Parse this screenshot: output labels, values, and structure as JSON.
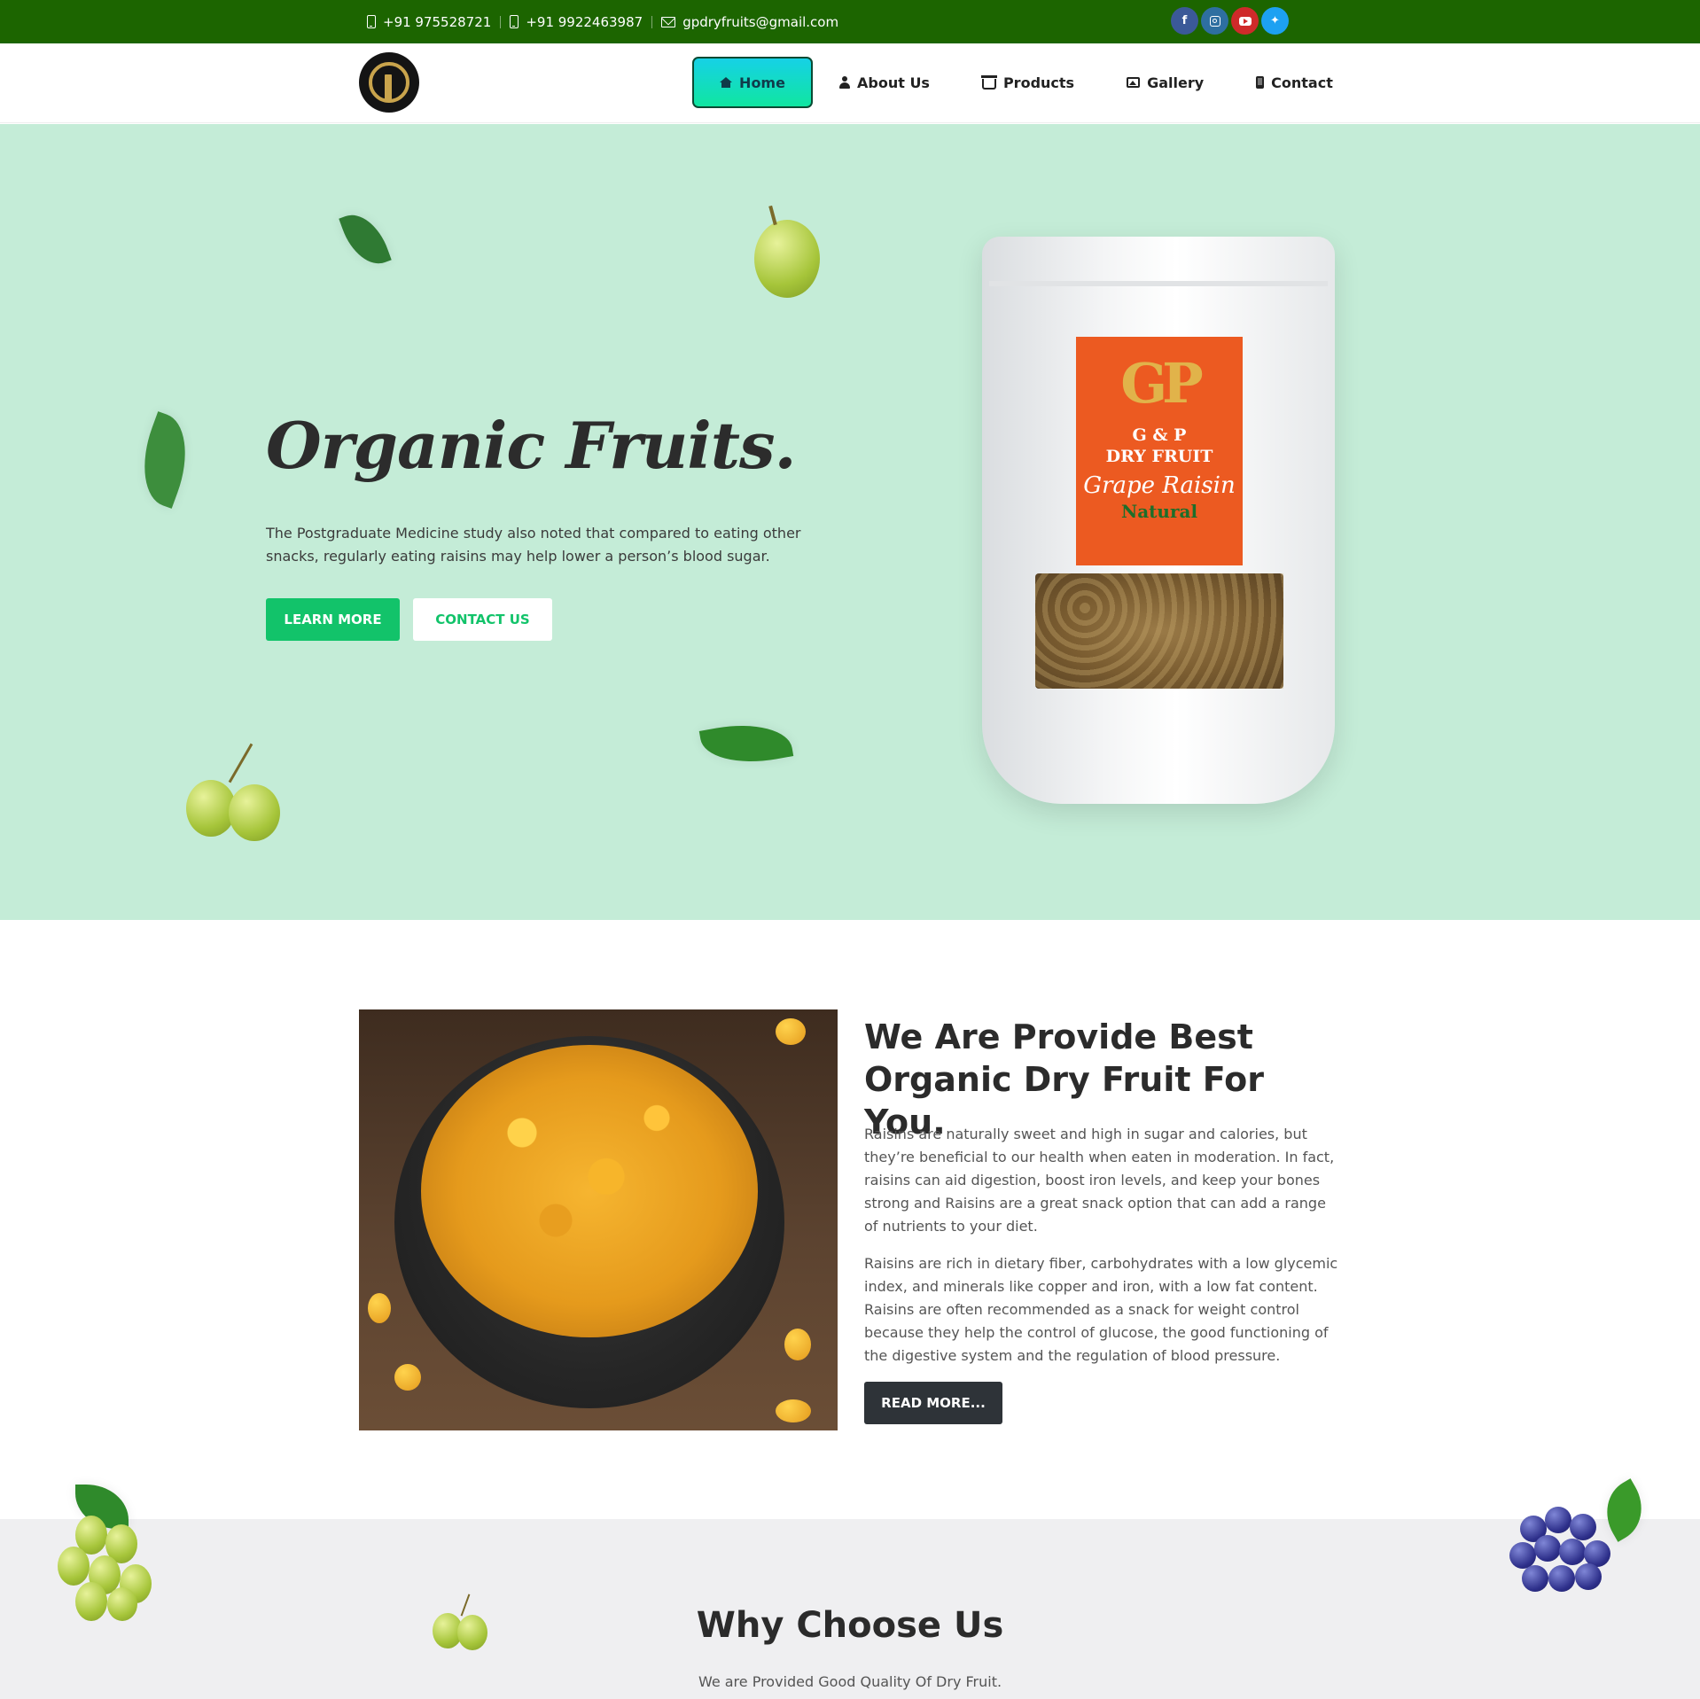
{
  "topbar": {
    "phone1": "+91 975528721",
    "phone2": "+91 9922463987",
    "email": "gpdryfruits@gmail.com",
    "social": [
      {
        "name": "facebook",
        "glyph": "f"
      },
      {
        "name": "instagram"
      },
      {
        "name": "youtube"
      },
      {
        "name": "twitter",
        "glyph": "✦"
      }
    ]
  },
  "nav": {
    "home": "Home",
    "about": "About Us",
    "products": "Products",
    "gallery": "Gallery",
    "contact": "Contact"
  },
  "hero": {
    "title": "Organic Fruits.",
    "text": "The Postgraduate Medicine study also noted that compared to eating other snacks, regularly eating raisins may help lower a person’s blood sugar.",
    "learn_more": "LEARN MORE",
    "contact_us": "CONTACT US"
  },
  "product": {
    "monogram": "GP",
    "brand_line1": "G & P",
    "brand_line2": "DRY FRUIT",
    "variety": "Grape Raisin",
    "type": "Natural"
  },
  "about": {
    "title": "We Are Provide Best Organic Dry Fruit For You.",
    "para1": "Raisins are naturally sweet and high in sugar and calories, but they’re beneficial to our health when eaten in moderation. In fact, raisins can aid digestion, boost iron levels, and keep your bones strong and Raisins are a great snack option that can add a range of nutrients to your diet.",
    "para2": "Raisins are rich in dietary fiber, carbohydrates with a low glycemic index, and minerals like copper and iron, with a low fat content. Raisins are often recommended as a snack for weight control because they help the control of glucose, the good functioning of the digestive system and the regulation of blood pressure.",
    "read_more": "READ MORE..."
  },
  "why": {
    "title": "Why Choose Us",
    "subtitle": "We are Provided Good Quality Of Dry Fruit."
  },
  "colors": {
    "topbar": "#1c6500",
    "hero_bg": "#c4ecd7",
    "accent_green": "#12c36a",
    "dark_button": "#2e3338",
    "section_grey": "#efeff1"
  }
}
